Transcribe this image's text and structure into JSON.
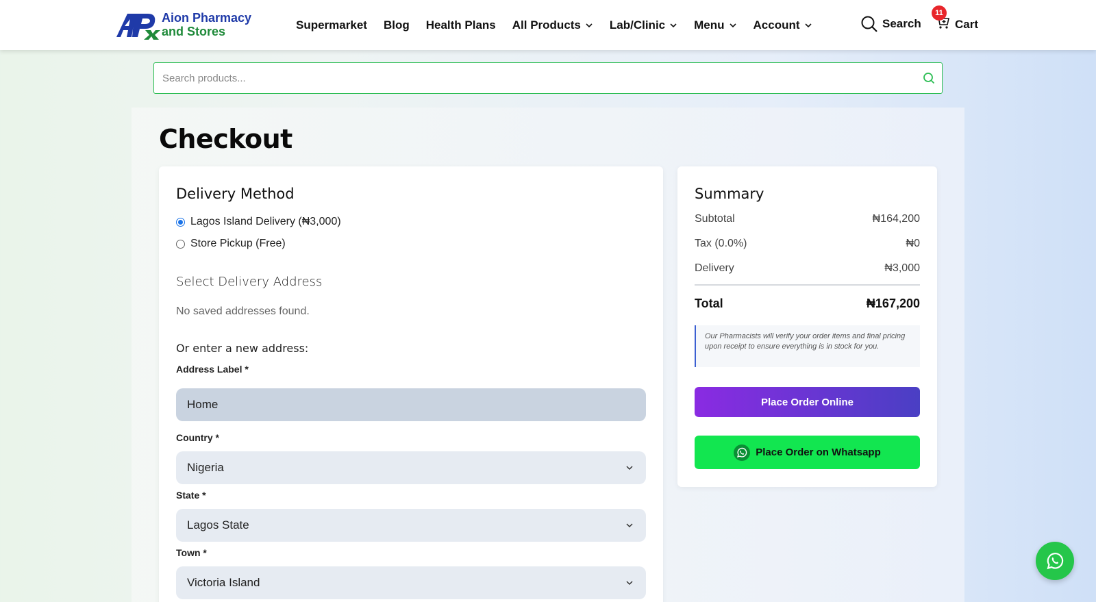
{
  "brand": {
    "line1": "Aion Pharmacy",
    "line2": "and Stores"
  },
  "nav": {
    "items": [
      {
        "label": "Supermarket",
        "has_dropdown": false
      },
      {
        "label": "Blog",
        "has_dropdown": false
      },
      {
        "label": "Health Plans",
        "has_dropdown": false
      },
      {
        "label": "All Products",
        "has_dropdown": true
      },
      {
        "label": "Lab/Clinic",
        "has_dropdown": true
      },
      {
        "label": "Menu",
        "has_dropdown": true
      },
      {
        "label": "Account",
        "has_dropdown": true
      }
    ],
    "search_label": "Search",
    "cart_label": "Cart",
    "cart_count": "11"
  },
  "search": {
    "placeholder": "Search products...",
    "value": ""
  },
  "page": {
    "title": "Checkout"
  },
  "delivery": {
    "heading": "Delivery Method",
    "options": [
      {
        "label": "Lagos Island Delivery (₦3,000)",
        "checked": true
      },
      {
        "label": "Store Pickup (Free)",
        "checked": false
      }
    ],
    "address_heading": "Select Delivery Address",
    "no_addresses": "No saved addresses found.",
    "new_address": "Or enter a new address:",
    "fields": {
      "address_label": {
        "label": "Address Label *",
        "value": "Home"
      },
      "country": {
        "label": "Country *",
        "value": "Nigeria"
      },
      "state": {
        "label": "State *",
        "value": "Lagos State"
      },
      "town": {
        "label": "Town *",
        "value": "Victoria Island"
      }
    }
  },
  "summary": {
    "heading": "Summary",
    "subtotal_label": "Subtotal",
    "subtotal_value": "₦164,200",
    "tax_label": "Tax (0.0%)",
    "tax_value": "₦0",
    "delivery_label": "Delivery",
    "delivery_value": "₦3,000",
    "total_label": "Total",
    "total_value": "₦167,200",
    "note": "Our Pharmacists will verify your order items and final pricing upon receipt to ensure everything is in stock for you.",
    "place_online": "Place Order Online",
    "place_whatsapp": "Place Order on Whatsapp"
  },
  "colors": {
    "accent_green": "#2bbd52",
    "online_btn_start": "#8a2be2",
    "online_btn_end": "#4a3fc4",
    "whatsapp_green": "#12e650",
    "badge_red": "#e8262b"
  }
}
